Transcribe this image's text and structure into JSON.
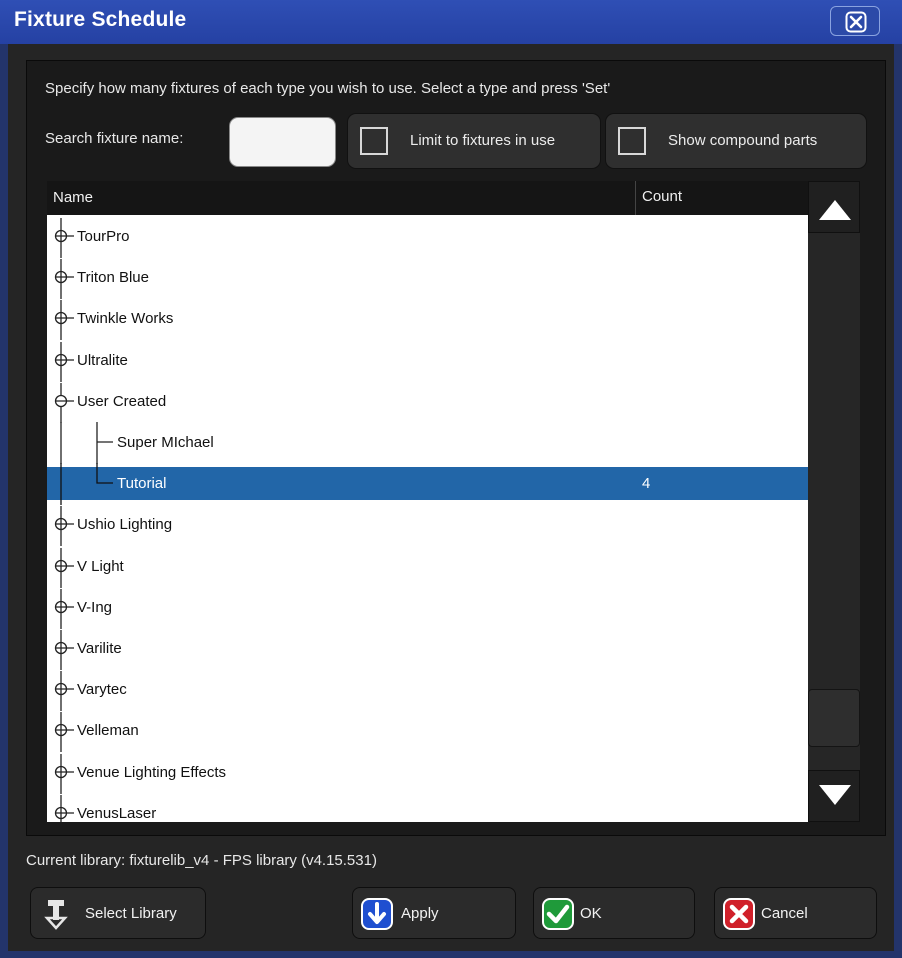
{
  "window": {
    "title": "Fixture Schedule"
  },
  "instruction": "Specify how many fixtures of each type you wish to use.  Select a type and press 'Set'",
  "search": {
    "label": "Search fixture name:",
    "value": ""
  },
  "toggles": {
    "limit_label": "Limit to fixtures in use",
    "compound_label": "Show compound parts"
  },
  "tree": {
    "columns": {
      "name": "Name",
      "count": "Count"
    },
    "rows": [
      {
        "name": "TourPro",
        "count": ""
      },
      {
        "name": "Triton Blue",
        "count": ""
      },
      {
        "name": "Twinkle Works",
        "count": ""
      },
      {
        "name": "Ultralite",
        "count": ""
      },
      {
        "name": "User Created",
        "count": ""
      },
      {
        "name": "Super MIchael",
        "count": ""
      },
      {
        "name": "Tutorial",
        "count": "4"
      },
      {
        "name": "Ushio Lighting",
        "count": ""
      },
      {
        "name": "V Light",
        "count": ""
      },
      {
        "name": "V-Ing",
        "count": ""
      },
      {
        "name": "Varilite",
        "count": ""
      },
      {
        "name": "Varytec",
        "count": ""
      },
      {
        "name": "Velleman",
        "count": ""
      },
      {
        "name": "Venue Lighting Effects",
        "count": ""
      },
      {
        "name": "VenusLaser",
        "count": ""
      }
    ]
  },
  "current_library": "Current library:  fixturelib_v4 - FPS library  (v4.15.531)",
  "buttons": {
    "select_library": "Select Library",
    "apply": "Apply",
    "ok": "OK",
    "cancel": "Cancel"
  },
  "colors": {
    "title_bar": "#2541a3",
    "selection": "#2266a8",
    "apply_icon": "#1f4fd0",
    "ok_icon": "#1f9a3a",
    "cancel_icon": "#d0202a"
  },
  "icons": {
    "close": "close-icon",
    "expand": "plus-circle-icon",
    "collapse": "minus-circle-icon",
    "library": "library-icon",
    "apply": "arrow-down-icon",
    "ok": "check-icon",
    "cancel": "x-icon"
  }
}
